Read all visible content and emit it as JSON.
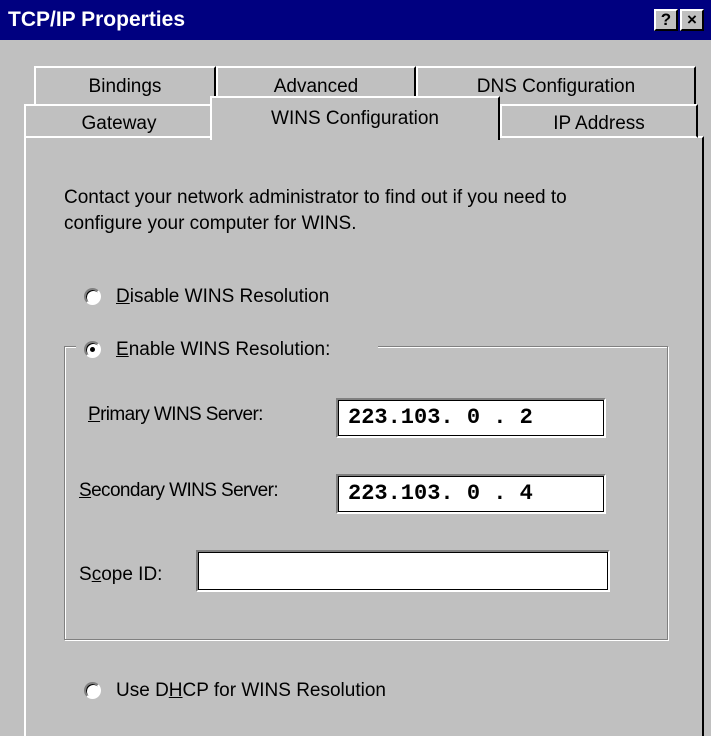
{
  "window": {
    "title": "TCP/IP Properties",
    "help_button": "?",
    "close_button": "×"
  },
  "tabs": {
    "back_row": [
      "Bindings",
      "Advanced",
      "DNS Configuration"
    ],
    "front_row": [
      "Gateway",
      "WINS Configuration",
      "IP Address"
    ],
    "active": "WINS Configuration"
  },
  "content": {
    "intro_line1": "Contact your network administrator to find out if you need to",
    "intro_line2": "configure your computer for WINS.",
    "disable_option": {
      "mnemonic": "D",
      "rest": "isable WINS Resolution",
      "selected": false
    },
    "enable_option": {
      "mnemonic": "E",
      "rest": "nable WINS Resolution:",
      "selected": true
    },
    "primary_label": {
      "mnemonic": "P",
      "rest": "rimary WINS Server:"
    },
    "primary_value": "223.103. 0 . 2",
    "secondary_label": {
      "mnemonic": "S",
      "rest": "econdary WINS Server:"
    },
    "secondary_value": "223.103. 0 . 4",
    "scope_label": {
      "pre": "S",
      "mnemonic": "c",
      "rest": "ope ID:"
    },
    "scope_value": "",
    "dhcp_option": {
      "pre": "Use D",
      "mnemonic": "H",
      "rest": "CP for WINS Resolution",
      "selected": false
    }
  }
}
